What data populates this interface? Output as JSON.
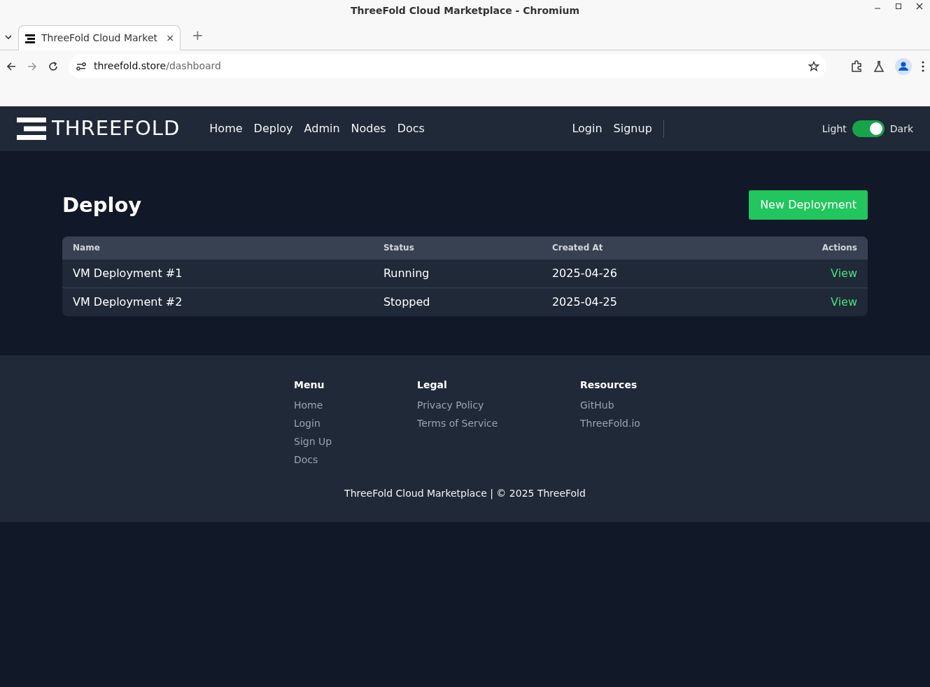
{
  "window": {
    "title": "ThreeFold Cloud Marketplace - Chromium"
  },
  "browser": {
    "tab_title": "ThreeFold Cloud Market",
    "tab_close": "×",
    "new_tab": "+",
    "url_host": "threefold.store",
    "url_path": "/dashboard"
  },
  "navbar": {
    "logo": "THREEFOLD",
    "links": [
      "Home",
      "Deploy",
      "Admin",
      "Nodes",
      "Docs"
    ],
    "auth_links": [
      "Login",
      "Signup"
    ],
    "theme_toggle": {
      "left_label": "Light",
      "right_label": "Dark",
      "on": true
    }
  },
  "page": {
    "title": "Deploy",
    "new_button": "New Deployment"
  },
  "table": {
    "columns": [
      "Name",
      "Status",
      "Created At",
      "Actions"
    ],
    "rows": [
      {
        "name": "VM Deployment #1",
        "status": "Running",
        "created_at": "2025-04-26",
        "action": "View"
      },
      {
        "name": "VM Deployment #2",
        "status": "Stopped",
        "created_at": "2025-04-25",
        "action": "View"
      }
    ]
  },
  "footer": {
    "columns": [
      {
        "heading": "Menu",
        "links": [
          "Home",
          "Login",
          "Sign Up",
          "Docs"
        ]
      },
      {
        "heading": "Legal",
        "links": [
          "Privacy Policy",
          "Terms of Service"
        ]
      },
      {
        "heading": "Resources",
        "links": [
          "GitHub",
          "ThreeFold.io"
        ]
      }
    ],
    "copyright": "ThreeFold Cloud Marketplace | © 2025 ThreeFold"
  }
}
